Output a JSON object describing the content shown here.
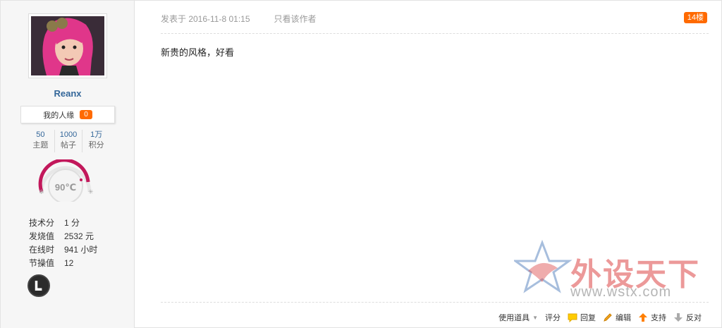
{
  "user": {
    "name": "Reanx",
    "relation_label": "我的人缘",
    "relation_value": "0",
    "stats": [
      {
        "value": "50",
        "label": "主题"
      },
      {
        "value": "1000",
        "label": "帖子"
      },
      {
        "value": "1万",
        "label": "积分"
      }
    ],
    "temperature": "90℃",
    "info": [
      {
        "key": "技术分",
        "value": "1 分"
      },
      {
        "key": "发烧值",
        "value": "2532 元"
      },
      {
        "key": "在线时",
        "value": "941 小时"
      },
      {
        "key": "节操值",
        "value": "12"
      }
    ]
  },
  "post": {
    "posted_at": "发表于 2016-11-8 01:15",
    "only_author": "只看该作者",
    "floor": "14楼",
    "content": "新贵的风格，好看"
  },
  "watermark": {
    "title": "外设天下",
    "url": "www.wstx.com"
  },
  "actions": {
    "tools": "使用道具",
    "rate": "评分",
    "reply": "回复",
    "edit": "编辑",
    "support": "支持",
    "oppose": "反对"
  },
  "colors": {
    "accent": "#ff6a00",
    "username": "#336699",
    "gauge": "#c2185b"
  }
}
